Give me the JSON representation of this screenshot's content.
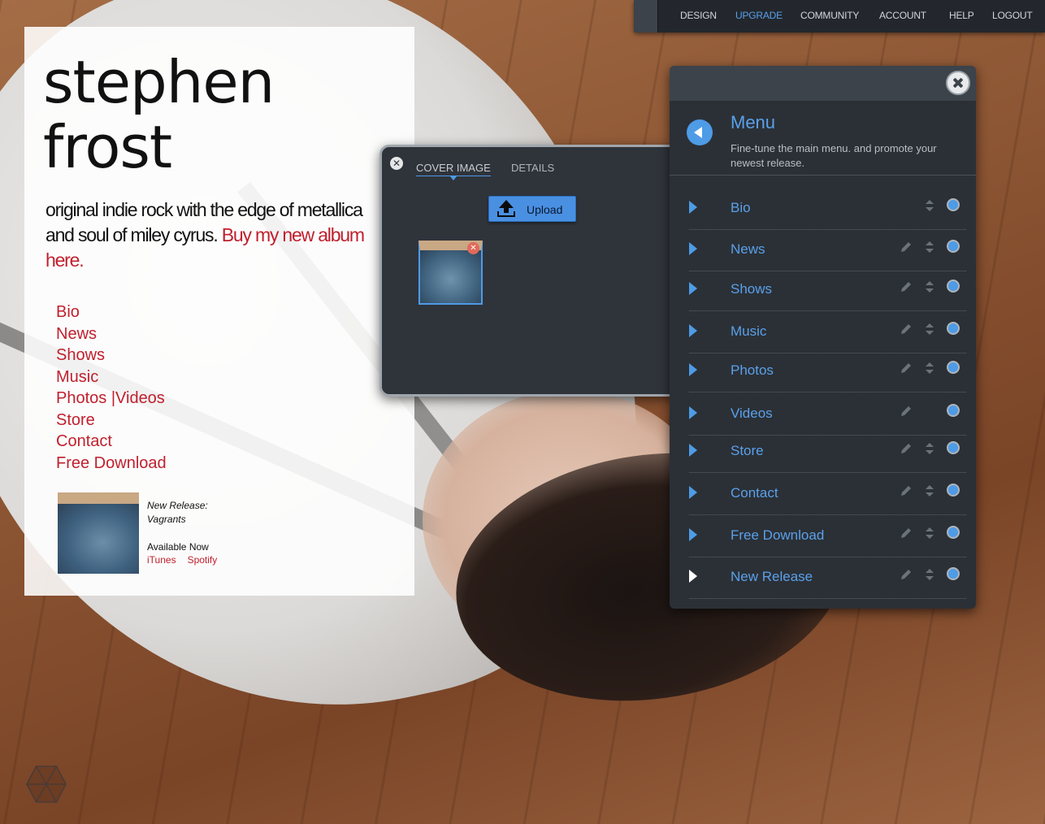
{
  "topnav": {
    "items": [
      "DESIGN",
      "UPGRADE",
      "COMMUNITY",
      "ACCOUNT",
      "HELP",
      "LOGOUT"
    ],
    "active": "UPGRADE",
    "accent": "#5aa0ea"
  },
  "site": {
    "title_line1": "stephen",
    "title_line2": "frost",
    "tagline": "original indie rock with the edge of metallica and soul of miley cyrus.",
    "buy_link": "Buy my new album here.",
    "nav": [
      "Bio",
      "News",
      "Shows",
      "Music",
      "Photos |Videos",
      "Store",
      "Contact",
      "Free Download"
    ],
    "release": {
      "label": "New Release:",
      "album": "Vagrants",
      "available": "Available Now",
      "link_itunes": "iTunes",
      "link_spotify": "Spotify"
    },
    "link_color": "#c0202e"
  },
  "cover_dialog": {
    "tab_cover": "COVER IMAGE",
    "tab_details": "DETAILS",
    "upload_label": "Upload"
  },
  "menu_panel": {
    "title": "Menu",
    "description": "Fine-tune the main menu. and promote your newest release.",
    "items": [
      {
        "label": "Bio",
        "editable": false,
        "sortable": true
      },
      {
        "label": "News",
        "editable": true,
        "sortable": true
      },
      {
        "label": "Shows",
        "editable": true,
        "sortable": true
      },
      {
        "label": "Music",
        "editable": true,
        "sortable": true
      },
      {
        "label": "Photos",
        "editable": true,
        "sortable": true
      },
      {
        "label": "Videos",
        "editable": true,
        "sortable": false
      },
      {
        "label": "Store",
        "editable": true,
        "sortable": true
      },
      {
        "label": "Contact",
        "editable": true,
        "sortable": true
      },
      {
        "label": "Free Download",
        "editable": true,
        "sortable": true
      },
      {
        "label": "New Release",
        "editable": true,
        "sortable": true
      }
    ],
    "accent": "#4e9be6"
  }
}
